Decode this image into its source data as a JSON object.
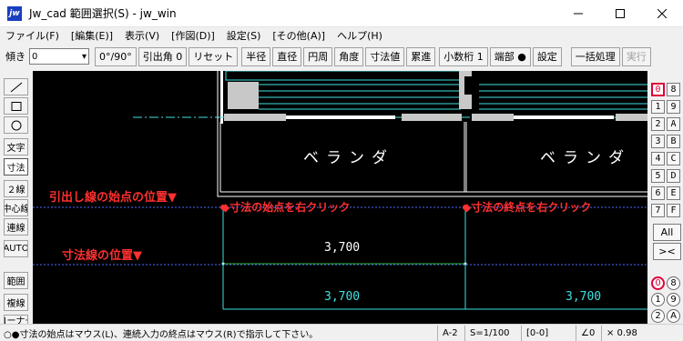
{
  "window": {
    "title": "Jw_cad 範囲選択(S) - jw_win",
    "app_icon_text": "jw"
  },
  "menu": [
    "ファイル(F)",
    "[編集(E)]",
    "表示(V)",
    "[作図(D)]",
    "設定(S)",
    "[その他(A)]",
    "ヘルプ(H)"
  ],
  "toolbar": {
    "tilt_label": "傾き",
    "tilt_value": "0",
    "buttons": [
      "0°/90°",
      "引出角 0",
      "リセット",
      "半径",
      "直径",
      "円周",
      "角度",
      "寸法値",
      "累進",
      "小数桁 1",
      "端部 ●",
      "設定",
      "一括処理"
    ],
    "disabled_button": "実行"
  },
  "left_tools": [
    "／",
    "□",
    "○",
    "文字",
    "寸法",
    "２線",
    "中心線",
    "連線",
    "AUTO",
    "範囲",
    "複線",
    "コーナー"
  ],
  "right_panel": {
    "layers": [
      [
        "0",
        "8"
      ],
      [
        "1",
        "9"
      ],
      [
        "2",
        "A"
      ],
      [
        "3",
        "B"
      ],
      [
        "4",
        "C"
      ],
      [
        "5",
        "D"
      ],
      [
        "6",
        "E"
      ],
      [
        "7",
        "F"
      ]
    ],
    "all_label": "All",
    "swap_label": "><",
    "groups": [
      [
        "0",
        "8"
      ],
      [
        "1",
        "9"
      ],
      [
        "2",
        "A"
      ]
    ]
  },
  "canvas": {
    "annotations": {
      "leader_start": "引出し線の始点の位置▼",
      "dim_line": "寸法線の位置▼",
      "dim_start": "◆寸法の始点を右クリック",
      "dim_end": "◆寸法の終点を右クリック"
    },
    "rooms": [
      "ベランダ",
      "ベランダ"
    ],
    "dimensions": {
      "upper": "3,700",
      "lower_left": "3,700",
      "lower_right": "3,700"
    },
    "colors": {
      "annotation": "#ff3030",
      "cyan": "#3fe0e0",
      "dotted_blue": "#4a6cff",
      "wall_gray": "#c0c0c0"
    }
  },
  "status": {
    "message": "○●寸法の始点はマウス(L)、連続入力の終点はマウス(R)で指示して下さい。",
    "paper": "A-2",
    "scale": "S=1/100",
    "layer": "[0-0]",
    "angle": "∠0",
    "zoom": "× 0.98"
  }
}
